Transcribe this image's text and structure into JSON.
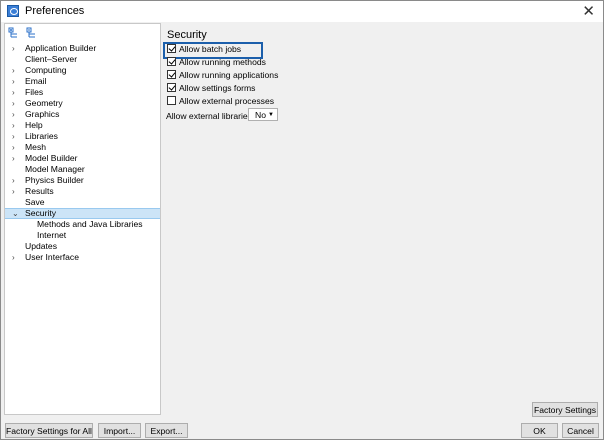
{
  "window": {
    "title": "Preferences"
  },
  "tree": {
    "items": [
      {
        "label": "Application Builder",
        "expandable": true
      },
      {
        "label": "Client–Server",
        "expandable": false
      },
      {
        "label": "Computing",
        "expandable": true
      },
      {
        "label": "Email",
        "expandable": true
      },
      {
        "label": "Files",
        "expandable": true
      },
      {
        "label": "Geometry",
        "expandable": true
      },
      {
        "label": "Graphics",
        "expandable": true
      },
      {
        "label": "Help",
        "expandable": true
      },
      {
        "label": "Libraries",
        "expandable": true
      },
      {
        "label": "Mesh",
        "expandable": true
      },
      {
        "label": "Model Builder",
        "expandable": true
      },
      {
        "label": "Model Manager",
        "expandable": false
      },
      {
        "label": "Physics Builder",
        "expandable": true
      },
      {
        "label": "Results",
        "expandable": true
      },
      {
        "label": "Save",
        "expandable": false
      },
      {
        "label": "Security",
        "expandable": true,
        "expanded": true,
        "selected": true
      },
      {
        "label": "Methods and Java Libraries",
        "child": true
      },
      {
        "label": "Internet",
        "child": true
      },
      {
        "label": "Updates",
        "expandable": false
      },
      {
        "label": "User Interface",
        "expandable": true
      }
    ]
  },
  "security": {
    "title": "Security",
    "options": [
      {
        "label": "Allow batch jobs",
        "checked": true
      },
      {
        "label": "Allow running methods",
        "checked": true
      },
      {
        "label": "Allow running applications",
        "checked": true
      },
      {
        "label": "Allow settings forms",
        "checked": true
      },
      {
        "label": "Allow external processes",
        "checked": false
      }
    ],
    "external_libraries_label": "Allow external libraries:",
    "external_libraries_value": "No"
  },
  "buttons": {
    "factory_settings": "Factory Settings",
    "factory_settings_all": "Factory Settings for All",
    "import": "Import...",
    "export": "Export...",
    "ok": "OK",
    "cancel": "Cancel"
  },
  "colors": {
    "selection": "#cce4f7",
    "focus": "#1c5fab"
  }
}
